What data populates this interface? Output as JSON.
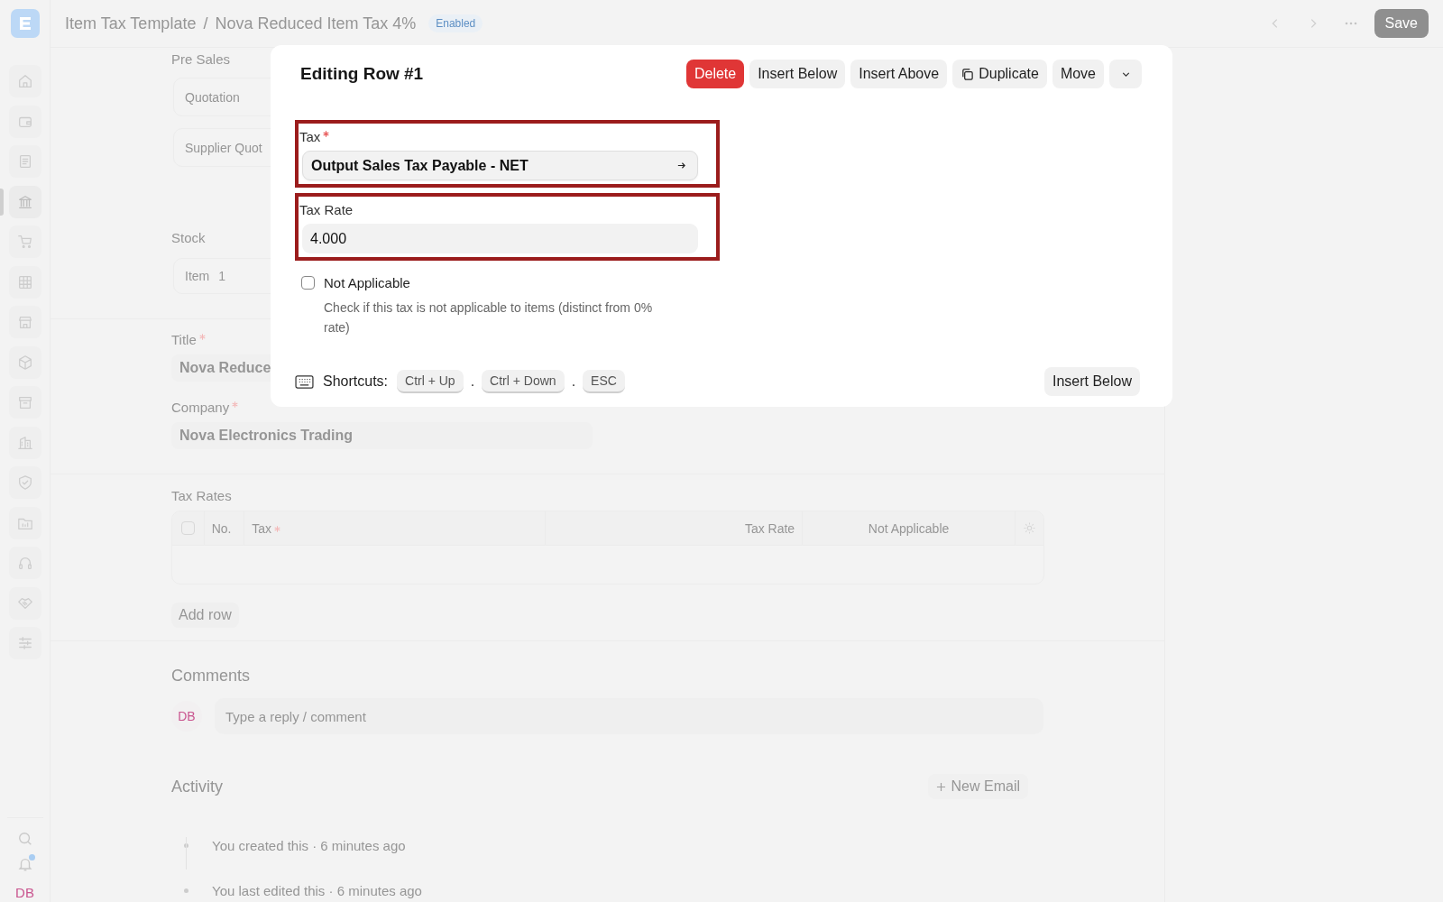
{
  "sidebar": {
    "items": [
      {
        "selected": false
      },
      {
        "selected": false
      },
      {
        "selected": false
      },
      {
        "selected": true
      },
      {
        "selected": false
      },
      {
        "selected": false
      },
      {
        "selected": false
      },
      {
        "selected": false
      },
      {
        "selected": false
      },
      {
        "selected": false
      },
      {
        "selected": false
      },
      {
        "selected": false
      },
      {
        "selected": false
      },
      {
        "selected": false
      },
      {
        "selected": false
      }
    ],
    "notification_dot": true,
    "avatar": "DB"
  },
  "header": {
    "breadcrumb": "Item Tax Template",
    "separator": "/",
    "title": "Nova Reduced Item Tax 4%",
    "status": "Enabled",
    "save": "Save"
  },
  "form": {
    "pre_sales": {
      "heading": "Pre Sales",
      "items": [
        "Quotation",
        "Supplier Quot"
      ]
    },
    "stock": {
      "heading": "Stock",
      "items": [
        {
          "label": "Item",
          "count": "1"
        }
      ]
    },
    "title": {
      "label": "Title",
      "required": true,
      "value": "Nova Reduce"
    },
    "company": {
      "label": "Company",
      "required": true,
      "value": "Nova Electronics Trading"
    },
    "tax_rates": {
      "label": "Tax Rates",
      "select_all": {
        "checked": false
      },
      "columns": [
        {
          "label": "No.",
          "required": false
        },
        {
          "label": "Tax",
          "required": true
        },
        {
          "label": "Tax Rate",
          "required": false
        },
        {
          "label": "Not Applicable",
          "required": false
        }
      ],
      "add_row": "Add row"
    }
  },
  "comments": {
    "heading": "Comments",
    "avatar": "DB",
    "placeholder": "Type a reply / comment"
  },
  "activity": {
    "heading": "Activity",
    "new_email": "New Email",
    "items": [
      "You created this · 6 minutes ago",
      "You last edited this · 6 minutes ago"
    ]
  },
  "dialog": {
    "title": "Editing Row #1",
    "actions": [
      {
        "label": "Delete",
        "kind": "danger"
      },
      {
        "label": "Insert Below",
        "kind": "plain"
      },
      {
        "label": "Insert Above",
        "kind": "plain"
      },
      {
        "label": "Duplicate",
        "kind": "copy"
      },
      {
        "label": "Move",
        "kind": "plain"
      }
    ],
    "fields": [
      {
        "kind": "link",
        "label": "Tax",
        "required": true,
        "value": "Output Sales Tax Payable - NET",
        "highlighted": true
      },
      {
        "kind": "number",
        "label": "Tax Rate",
        "required": false,
        "value": "4.000",
        "highlighted": true
      }
    ],
    "checkbox": {
      "label": "Not Applicable",
      "checked": false,
      "description": "Check if this tax is not applicable to items (distinct from 0% rate)"
    },
    "shortcuts": {
      "label": "Shortcuts:",
      "keys": [
        {
          "key": "Ctrl + Up",
          "separator": "."
        },
        {
          "key": "Ctrl + Down",
          "separator": "."
        },
        {
          "key": "ESC"
        }
      ]
    },
    "footer_button": "Insert Below"
  }
}
